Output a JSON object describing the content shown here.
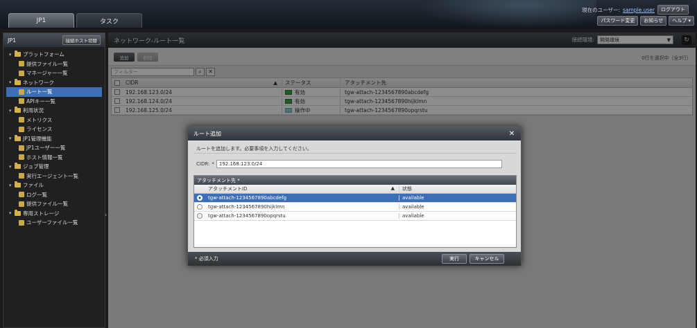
{
  "topbar": {
    "tab_jp1": "JP1",
    "tab_task": "タスク",
    "current_user_label": "現在のユーザー:",
    "user_name": "sample.user",
    "logout": "ログアウト",
    "password_change": "パスワード変更",
    "notices": "お知らせ",
    "help": "ヘルプ ▾"
  },
  "leftpanel": {
    "title": "JP1",
    "conn_host_button": "接続ホスト切替",
    "tree": [
      {
        "label": "プラットフォーム",
        "level": 1,
        "toggle": "▾"
      },
      {
        "label": "提供ファイル一覧",
        "level": 2
      },
      {
        "label": "マネージャー一覧",
        "level": 2
      },
      {
        "label": "ネットワーク",
        "level": 1,
        "toggle": "▾"
      },
      {
        "label": "ルート一覧",
        "level": 2,
        "selected": true
      },
      {
        "label": "APIキー一覧",
        "level": 2
      },
      {
        "label": "利用状況",
        "level": 1,
        "toggle": "▾"
      },
      {
        "label": "メトリクス",
        "level": 2
      },
      {
        "label": "ライセンス",
        "level": 2
      },
      {
        "label": "JP1管理機能",
        "level": 1,
        "toggle": "▾"
      },
      {
        "label": "JP1ユーザー一覧",
        "level": 2
      },
      {
        "label": "ホスト情報一覧",
        "level": 2
      },
      {
        "label": "ジョブ管理",
        "level": 1,
        "toggle": "▾"
      },
      {
        "label": "実行エージェント一覧",
        "level": 2
      },
      {
        "label": "ファイル",
        "level": 1,
        "toggle": "▾"
      },
      {
        "label": "ログ一覧",
        "level": 2
      },
      {
        "label": "提供ファイル一覧",
        "level": 2
      },
      {
        "label": "専用ストレージ",
        "level": 1,
        "toggle": "▾"
      },
      {
        "label": "ユーザーファイル一覧",
        "level": 2
      }
    ]
  },
  "main": {
    "title": "ネットワーク-ルート一覧",
    "env_label": "接続環境:",
    "env_value": "開発環境",
    "add_button": "追加",
    "delete_button": "削除",
    "count_text": "0行を選択中（全3行）",
    "filter_placeholder": "フィルター",
    "columns": {
      "cidr": "CIDR",
      "status": "ステータス",
      "attachment": "アタッチメント先"
    },
    "rows": [
      {
        "cidr": "192.168.123.0/24",
        "status": "有効",
        "status_kind": "ok",
        "attachment": "tgw-attach-1234567890abcdefg"
      },
      {
        "cidr": "192.168.124.0/24",
        "status": "有効",
        "status_kind": "ok",
        "attachment": "tgw-attach-1234567890hijklmn"
      },
      {
        "cidr": "192.168.125.0/24",
        "status": "操作中",
        "status_kind": "busy",
        "attachment": "tgw-attach-1234567890opqrstu"
      }
    ]
  },
  "dialog": {
    "title": "ルート追加",
    "close": "✕",
    "message": "ルートを追加します。必要事項を入力してください。",
    "cidr_label": "CIDR:",
    "cidr_req": "*",
    "cidr_value": "192.168.123.0/24",
    "attach_section_title": "アタッチメント先 *",
    "attach_columns": {
      "id": "アタッチメントID",
      "state": "状態"
    },
    "attach_rows": [
      {
        "id": "tgw-attach-1234567890abcdefg",
        "state": "available",
        "selected": true
      },
      {
        "id": "tgw-attach-1234567890hijklmn",
        "state": "available",
        "selected": false
      },
      {
        "id": "tgw-attach-1234567890opqrstu",
        "state": "available",
        "selected": false
      }
    ],
    "required_note": "* 必須入力",
    "execute": "実行",
    "cancel": "キャンセル"
  },
  "colors": {
    "accent": "#3c6fb6",
    "ok": "#39a140",
    "busy": "#8ad6d0",
    "folder": "#d6b24a"
  }
}
